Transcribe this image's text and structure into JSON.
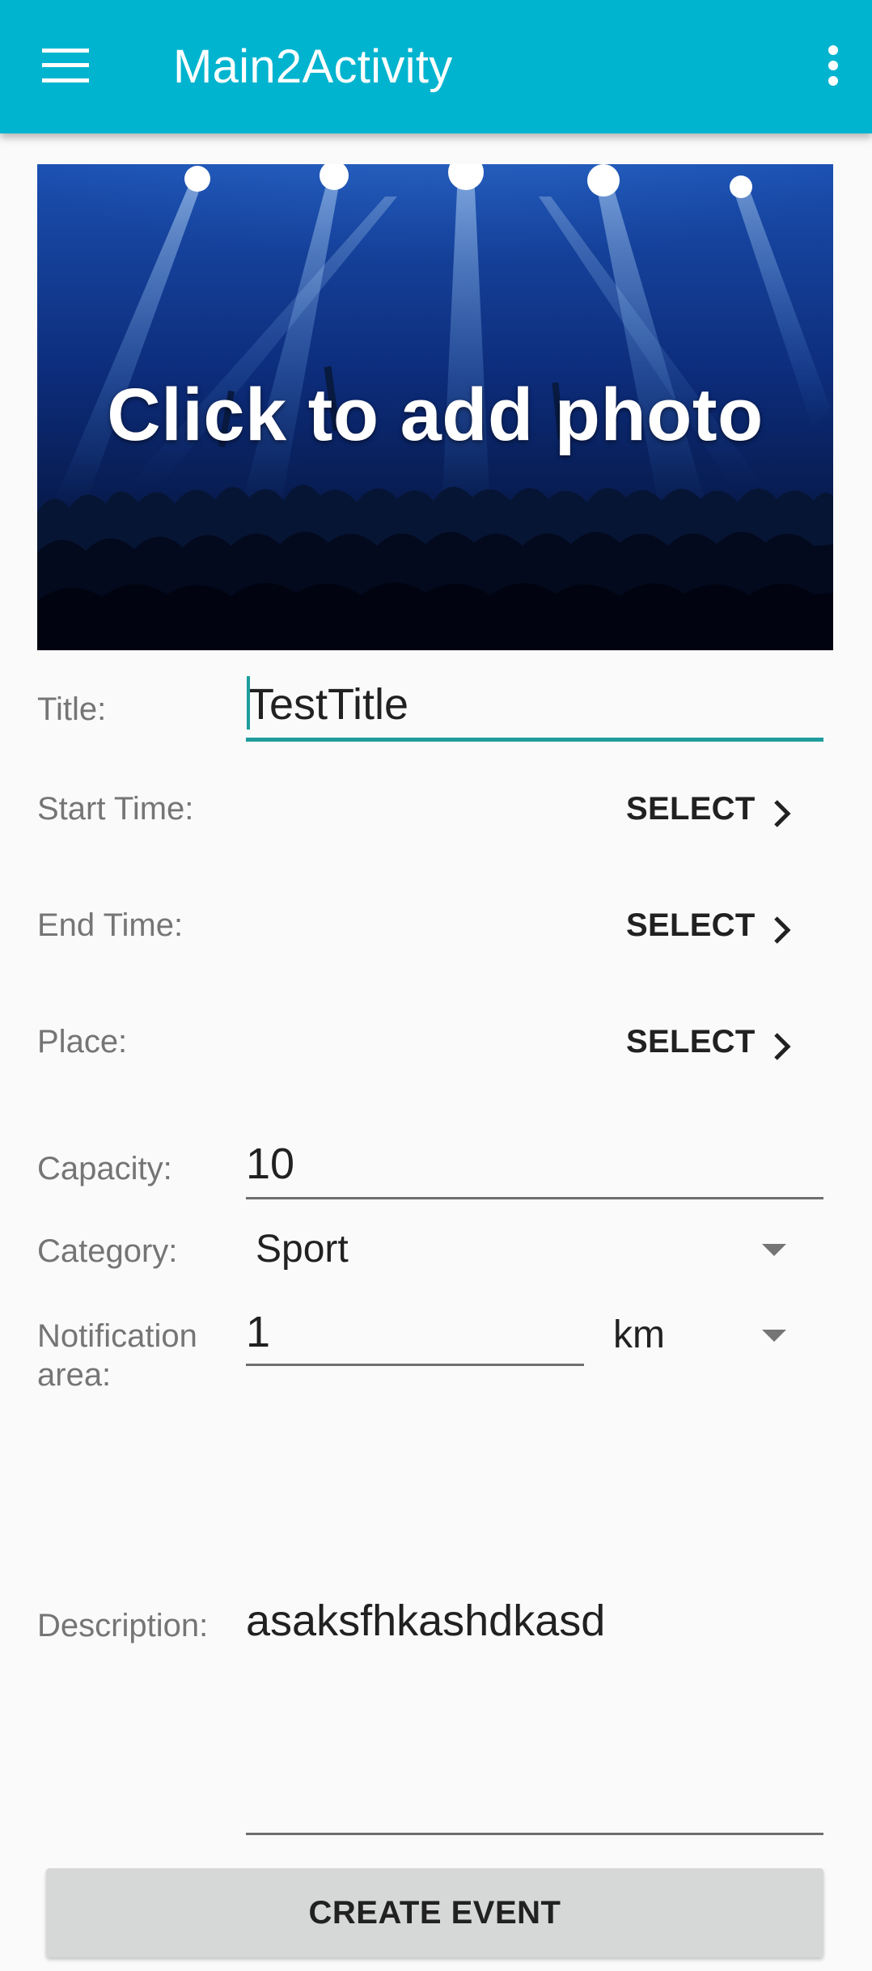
{
  "app_bar": {
    "title": "Main2Activity",
    "menu_icon": "hamburger-menu-icon",
    "overflow_icon": "more-vert-icon",
    "background_color": "#00b4cf"
  },
  "banner": {
    "text": "Click to add photo"
  },
  "form": {
    "title": {
      "label": "Title:",
      "value": "TestTitle"
    },
    "start_time": {
      "label": "Start Time:",
      "button": "SELECT"
    },
    "end_time": {
      "label": "End Time:",
      "button": "SELECT"
    },
    "place": {
      "label": "Place:",
      "button": "SELECT"
    },
    "capacity": {
      "label": "Capacity:",
      "value": "10"
    },
    "category": {
      "label": "Category:",
      "selected": "Sport"
    },
    "notification_area": {
      "label_line1": "Notification",
      "label_line2": "area:",
      "value": "1",
      "unit": "km"
    },
    "description": {
      "label": "Description:",
      "value": "asaksfhkashdkasd"
    }
  },
  "create_button": {
    "label": "CREATE EVENT"
  },
  "accent_color": "#1f9c9c"
}
